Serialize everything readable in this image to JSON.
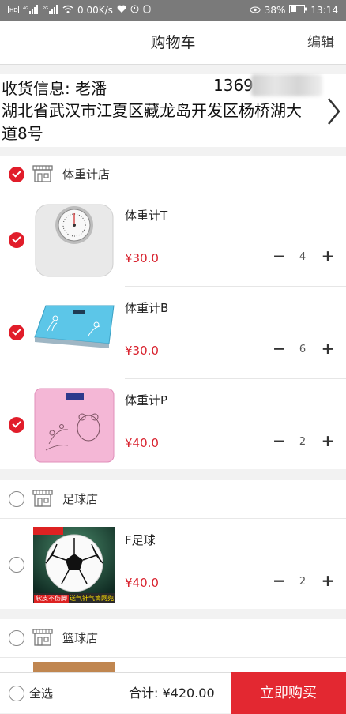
{
  "status_bar": {
    "left_icons": [
      "hd-icon",
      "signal-icon",
      "signal-icon",
      "wifi-icon"
    ],
    "net_speed": "0.00K/s",
    "battery": "38%",
    "time": "13:14"
  },
  "header": {
    "title": "购物车",
    "edit_label": "编辑"
  },
  "address": {
    "label": "收货信息: 老潘",
    "phone_visible": "1369",
    "detail": "湖北省武汉市江夏区藏龙岛开发区杨桥湖大道8号"
  },
  "shops": [
    {
      "name": "体重计店",
      "checked": true,
      "items": [
        {
          "name": "体重计T",
          "price": "¥30.0",
          "qty": "4",
          "checked": true
        },
        {
          "name": "体重计B",
          "price": "¥30.0",
          "qty": "6",
          "checked": true
        },
        {
          "name": "体重计P",
          "price": "¥40.0",
          "qty": "2",
          "checked": true
        }
      ]
    },
    {
      "name": "足球店",
      "checked": false,
      "items": [
        {
          "name": "F足球",
          "price": "¥40.0",
          "qty": "2",
          "checked": false,
          "banner_top": "",
          "banner_left": "软皮不伤脚",
          "banner_right": "送气针气筒网兜"
        }
      ]
    },
    {
      "name": "篮球店",
      "checked": false,
      "items": []
    }
  ],
  "footer": {
    "select_all_label": "全选",
    "total_label": "合计:",
    "total_value": "¥420.00",
    "buy_label": "立即购买"
  },
  "colors": {
    "accent": "#e32831",
    "price": "#d8202c"
  }
}
